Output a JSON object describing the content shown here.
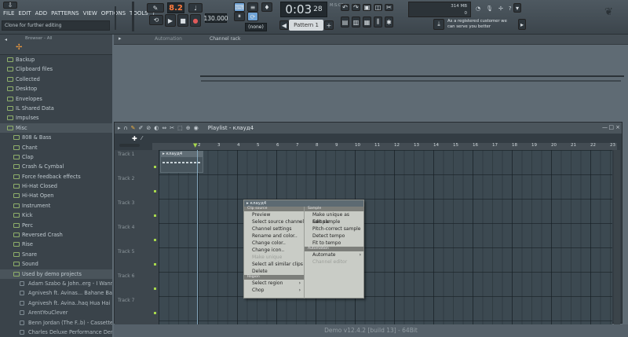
{
  "menu": [
    "FILE",
    "EDIT",
    "ADD",
    "PATTERNS",
    "VIEW",
    "OPTIONS",
    "TOOLS",
    "?"
  ],
  "hint": "Clone for further editing",
  "transport": {
    "pat_song": "8.2",
    "tempo": "130.000",
    "time_main": "0:03",
    "time_sub": "28",
    "tempo_mode": "(none)",
    "pattern": "Pattern 1",
    "time_label": "M:S:CS"
  },
  "cpu": {
    "memory": "314 MB",
    "cores": "0"
  },
  "notice": "As a registered customer we can serve you better",
  "browser": {
    "title": "Browser - All",
    "items": [
      {
        "label": "Backup",
        "level": 0
      },
      {
        "label": "Clipboard files",
        "level": 0
      },
      {
        "label": "Collected",
        "level": 0
      },
      {
        "label": "Desktop",
        "level": 0
      },
      {
        "label": "Envelopes",
        "level": 0
      },
      {
        "label": "IL Shared Data",
        "level": 0
      },
      {
        "label": "Impulses",
        "level": 0
      },
      {
        "label": "Misc",
        "level": 0,
        "hl": true
      },
      {
        "label": "808 & Bass",
        "level": 1
      },
      {
        "label": "Chant",
        "level": 1
      },
      {
        "label": "Clap",
        "level": 1
      },
      {
        "label": "Crash & Cymbal",
        "level": 1
      },
      {
        "label": "Force feedback effects",
        "level": 1
      },
      {
        "label": "Hi-Hat Closed",
        "level": 1
      },
      {
        "label": "Hi-Hat Open",
        "level": 1
      },
      {
        "label": "Instrument",
        "level": 1
      },
      {
        "label": "Kick",
        "level": 1
      },
      {
        "label": "Perc",
        "level": 1
      },
      {
        "label": "Reversed Crash",
        "level": 1
      },
      {
        "label": "Rise",
        "level": 1
      },
      {
        "label": "Snare",
        "level": 1
      },
      {
        "label": "Sound",
        "level": 1
      },
      {
        "label": "Used by demo projects",
        "level": 1,
        "hl": true
      },
      {
        "label": "Adam Szabo & John..erg - I Wanna Be",
        "level": 2
      },
      {
        "label": "Agnivesh ft. Avinas... Bahane Bana Kar",
        "level": 2
      },
      {
        "label": "Agnivesh ft. Avina..haq Hua Hai Mujhe",
        "level": 2
      },
      {
        "label": "ArentYouClever",
        "level": 2
      },
      {
        "label": "Benn Jordan (The F..b) - Cassette Cafe",
        "level": 2
      },
      {
        "label": "Charles Deluxe Performance Demo",
        "level": 2
      }
    ]
  },
  "rack": {
    "tab_automation": "Automation",
    "tab_channel": "Channel rack"
  },
  "playlist": {
    "title": "Playlist - клауд4",
    "pattern_name": "клауд4",
    "bars": [
      "2",
      "3",
      "4",
      "5",
      "6",
      "7",
      "8",
      "9",
      "10",
      "11",
      "12",
      "13",
      "14",
      "15",
      "16",
      "17",
      "18",
      "19",
      "20",
      "21",
      "22",
      "23"
    ],
    "tracks": [
      "Track 1",
      "Track 2",
      "Track 3",
      "Track 4",
      "Track 5",
      "Track 6",
      "Track 7"
    ]
  },
  "context": {
    "clip_name": "клауд4",
    "left_header": "Clip source",
    "left": [
      {
        "label": "Preview"
      },
      {
        "label": "Select source channel",
        "arrow": true
      },
      {
        "label": "Channel settings"
      },
      {
        "label": "Rename and color.."
      },
      {
        "label": "Change color.."
      },
      {
        "label": "Change icon.."
      },
      {
        "label": "Make unique",
        "dis": true
      },
      {
        "label": "Select all similar clips"
      },
      {
        "label": "Delete"
      }
    ],
    "left_header2": "Region",
    "left2": [
      {
        "label": "Select region",
        "arrow": true
      },
      {
        "label": "Chop",
        "arrow": true
      }
    ],
    "right_header": "Sample",
    "right": [
      {
        "label": "Make unique as sample"
      },
      {
        "label": "Edit sample"
      },
      {
        "label": "Pitch-correct sample"
      },
      {
        "label": "Detect tempo"
      },
      {
        "label": "Fit to tempo"
      }
    ],
    "right_header2": "Automation",
    "right2": [
      {
        "label": "Automate",
        "arrow": true
      },
      {
        "label": "Channel editor",
        "dis": true
      }
    ]
  },
  "status": "Demo v12.4.2 [build 13] - 64Bit",
  "colors": {
    "accent": "#6fa3d6",
    "track_dot": "#a7d84c",
    "pattern_lcd": "#ff7a3d"
  }
}
